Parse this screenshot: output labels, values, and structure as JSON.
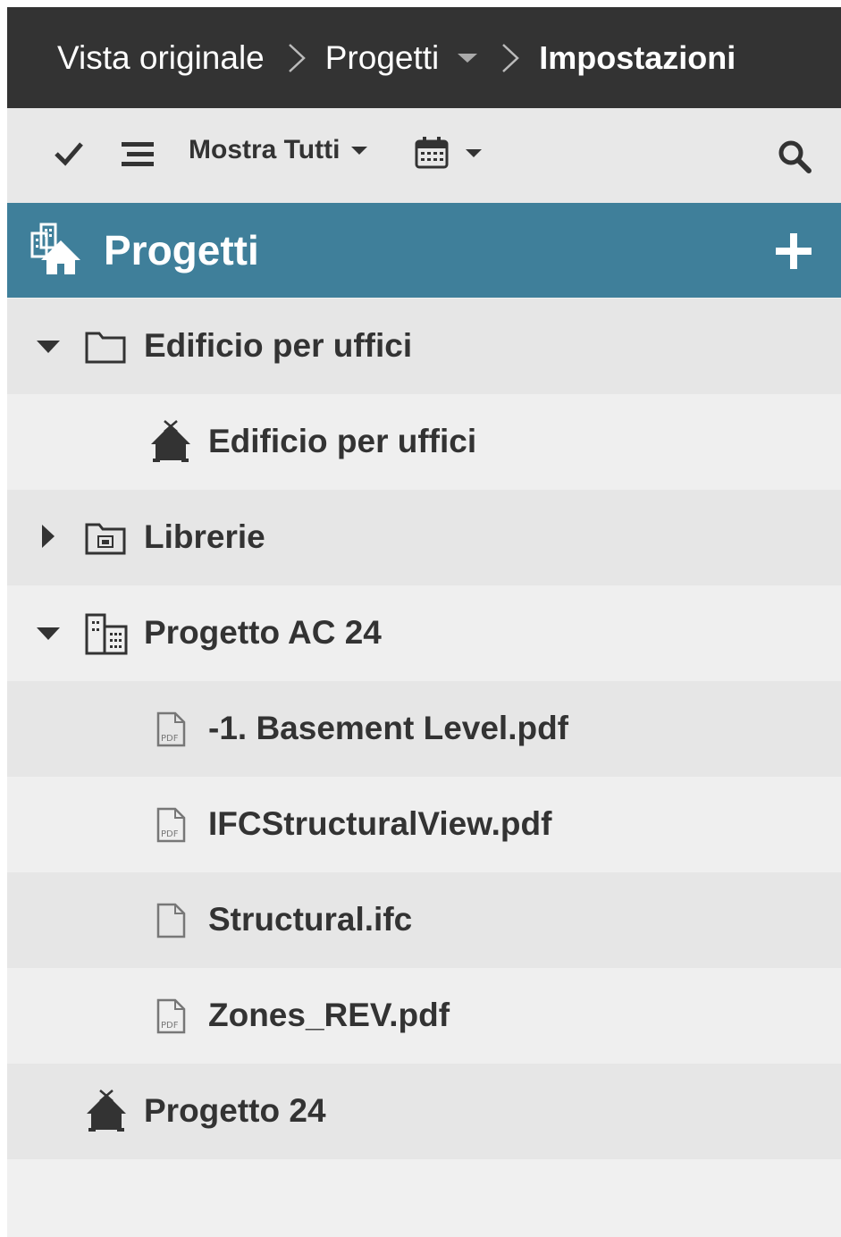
{
  "breadcrumb": {
    "items": [
      "Vista originale",
      "Progetti",
      "Impostazioni"
    ]
  },
  "toolbar": {
    "filter_label": "Mostra Tutti",
    "icons": [
      "checkmark-icon",
      "list-icon",
      "calendar-icon",
      "search-icon"
    ]
  },
  "panel": {
    "title": "Progetti",
    "add_icon": "plus-icon"
  },
  "tree": [
    {
      "label": "Edificio per uffici",
      "icon": "folder-icon",
      "expanded": true
    },
    {
      "label": "Edificio per uffici",
      "icon": "house-icon"
    },
    {
      "label": "Librerie",
      "icon": "library-folder-icon",
      "expanded": false
    },
    {
      "label": "Progetto AC 24",
      "icon": "building-icon",
      "expanded": true
    },
    {
      "label": "-1. Basement Level.pdf",
      "icon": "pdf-file-icon"
    },
    {
      "label": "IFCStructuralView.pdf",
      "icon": "pdf-file-icon"
    },
    {
      "label": "Structural.ifc",
      "icon": "file-icon"
    },
    {
      "label": "Zones_REV.pdf",
      "icon": "pdf-file-icon"
    },
    {
      "label": "Progetto 24",
      "icon": "house-icon"
    }
  ],
  "colors": {
    "breadcrumb_bg": "#333333",
    "toolbar_bg": "#e8e8e8",
    "header_bg": "#3f7f9a",
    "row_dark": "#e6e6e6",
    "row_light": "#efefef",
    "text": "#333333"
  }
}
